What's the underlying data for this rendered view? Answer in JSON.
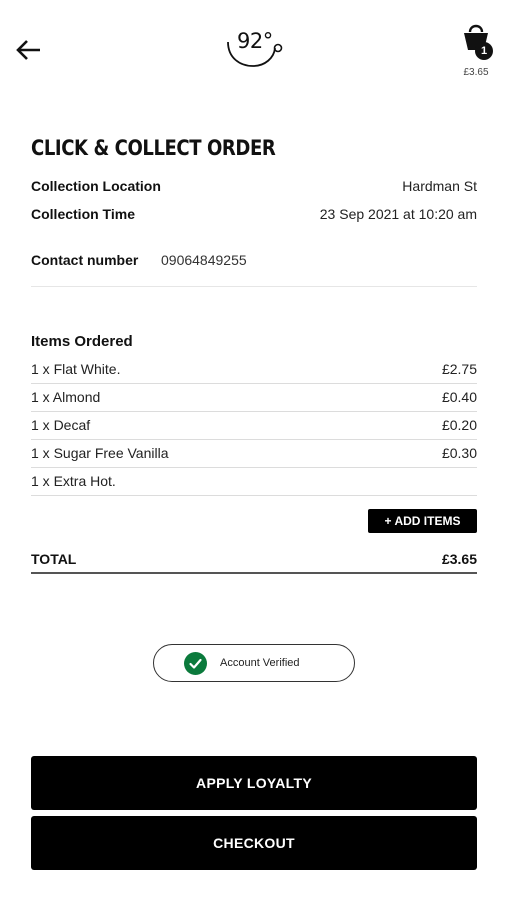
{
  "header": {
    "back_icon": "arrow-left-icon",
    "logo_text": "92°",
    "cart_icon": "shopping-bag-icon",
    "cart_count": "1",
    "cart_total": "£3.65"
  },
  "order": {
    "title": "CLICK & COLLECT ORDER",
    "collection_location_label": "Collection Location",
    "collection_location_value": "Hardman St",
    "collection_time_label": "Collection Time",
    "collection_time_value": "23 Sep 2021 at 10:20 am",
    "contact_label": "Contact number",
    "contact_value": "09064849255"
  },
  "items": {
    "heading": "Items Ordered",
    "rows": [
      {
        "name": "1 x Flat White.",
        "price": "£2.75"
      },
      {
        "name": "1 x Almond",
        "price": "£0.40"
      },
      {
        "name": "1 x Decaf",
        "price": "£0.20"
      },
      {
        "name": "1 x Sugar Free Vanilla",
        "price": "£0.30"
      },
      {
        "name": "1 x Extra Hot.",
        "price": ""
      }
    ],
    "add_items_label": "+ ADD ITEMS"
  },
  "total": {
    "label": "TOTAL",
    "value": "£3.65"
  },
  "verified": {
    "label": "Account Verified",
    "color": "#0b7a3c"
  },
  "buttons": {
    "apply_loyalty": "APPLY LOYALTY",
    "checkout": "CHECKOUT"
  }
}
